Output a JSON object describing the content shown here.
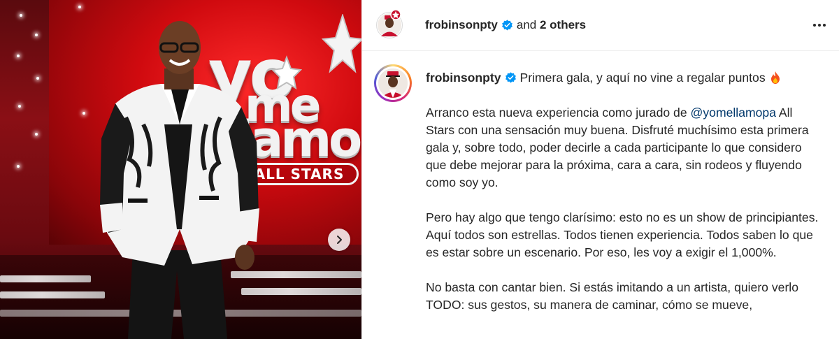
{
  "post": {
    "media": {
      "logo_lines": [
        "yo",
        "me",
        "llamo"
      ],
      "logo_badge": "ALL STARS",
      "next_icon": "chevron-right-icon"
    },
    "header": {
      "username": "frobinsonpty",
      "and_text": "and",
      "others_text": "2 others",
      "more_icon": "more-horizontal-icon"
    },
    "caption": {
      "username": "frobinsonpty",
      "first_line": "Primera gala, y aquí no vine a regalar puntos",
      "p1_before": "Arranco esta nueva experiencia como jurado de ",
      "p1_mention": "@yomellamopa",
      "p1_after": " All Stars con una sensación muy buena. Disfruté muchísimo esta primera gala y, sobre todo, poder decirle a cada participante lo que considero que debe mejorar para la próxima, cara a cara, sin rodeos y fluyendo como soy yo.",
      "p2": "Pero hay algo que tengo clarísimo: esto no es un show de principiantes. Aquí todos son estrellas. Todos tienen experiencia. Todos saben lo que es estar sobre un escenario. Por eso, les voy a exigir el 1,000%.",
      "p3": "No basta con cantar bien. Si estás imitando a un artista, quiero verlo TODO: sus gestos, su manera de caminar, cómo se mueve,"
    },
    "colors": {
      "verified": "#0095f6",
      "mention": "#00376b",
      "text": "#262626"
    }
  }
}
